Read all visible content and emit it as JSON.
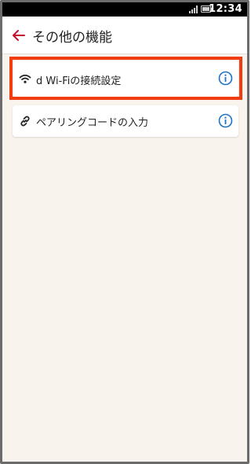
{
  "status_bar": {
    "time": "12:34",
    "icons": [
      "signal-icon",
      "battery-icon"
    ]
  },
  "app_bar": {
    "back_icon": "arrow-left-icon",
    "title": "その他の機能"
  },
  "colors": {
    "accent": "#c8102e",
    "highlight": "#f03c10",
    "info_icon": "#1a73c9",
    "background": "#f8f3ec"
  },
  "menu_items": [
    {
      "icon": "wifi-icon",
      "label": "d Wi-Fiの接続設定",
      "info_icon": "info-icon",
      "highlighted": true
    },
    {
      "icon": "link-icon",
      "label": "ペアリングコードの入力",
      "info_icon": "info-icon",
      "highlighted": false
    }
  ]
}
